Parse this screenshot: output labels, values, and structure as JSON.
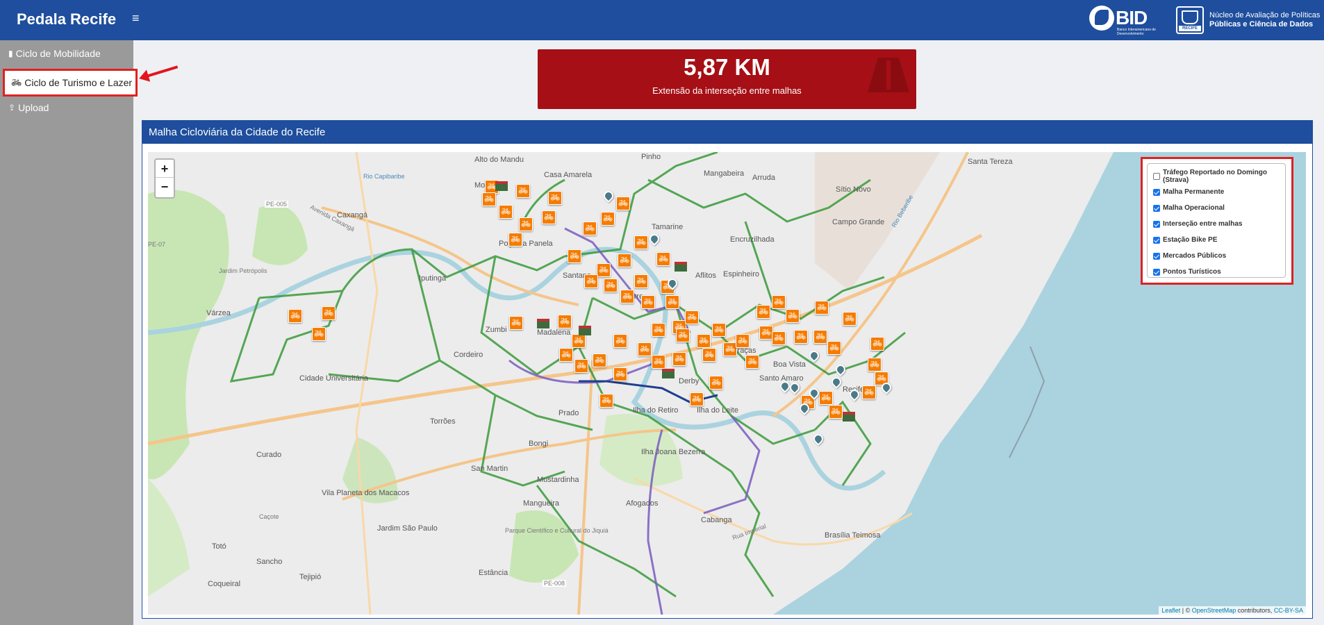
{
  "app": {
    "title": "Pedala Recife",
    "menu_icon": "hamburger-icon"
  },
  "header_logos": {
    "bid": {
      "text": "BID",
      "subtitle": "Banco Interamericano de Desenvolvimento"
    },
    "recife_badge": "RECIFE",
    "nucleo_line1": "Núcleo de Avaliação de Políticas",
    "nucleo_line2": "Públicas e Ciência de Dados"
  },
  "sidebar": {
    "items": [
      {
        "label": "Ciclo de Mobilidade",
        "icon": "traffic-light-icon"
      },
      {
        "label": "Ciclo de Turismo e Lazer",
        "icon": "bicycle-icon",
        "active": true
      },
      {
        "label": "Upload",
        "icon": "upload-icon"
      }
    ]
  },
  "kpi": {
    "value": "5,87 KM",
    "label": "Extensão da interseção entre malhas",
    "icon": "road-icon",
    "color": "#a50f15"
  },
  "panel": {
    "title": "Malha Cicloviária da Cidade do Recife"
  },
  "map": {
    "zoom_in": "+",
    "zoom_out": "−",
    "layers": [
      {
        "label": "Tráfego Reportado no Domingo (Strava)",
        "checked": false
      },
      {
        "label": "Malha Permanente",
        "checked": true
      },
      {
        "label": "Malha Operacional",
        "checked": true
      },
      {
        "label": "Interseção entre malhas",
        "checked": true
      },
      {
        "label": "Estação Bike PE",
        "checked": true
      },
      {
        "label": "Mercados Públicos",
        "checked": true
      },
      {
        "label": "Pontos Turísticos",
        "checked": true
      }
    ],
    "attribution": {
      "leaflet": "Leaflet",
      "sep": " | © ",
      "osm": "OpenStreetMap",
      "contrib": " contributors, ",
      "license": "CC-BY-SA"
    },
    "place_labels": [
      "Alto do Mandu",
      "Pinho",
      "Mangabeira",
      "Arruda",
      "Santa Tereza",
      "Casa Amarela",
      "Monteiro",
      "Sítio Novo",
      "Caxangá",
      "Tamarine",
      "Campo Grande",
      "Poço da Panela",
      "Santana",
      "Iputinga",
      "Jardim Petrópolis",
      "Várzea",
      "Torre",
      "Aflitos",
      "Cordeiro",
      "Cidade Universitária",
      "Derby",
      "Torrões",
      "Prado",
      "Ilha do Retiro",
      "Bongi",
      "Curado",
      "San Martin",
      "Mustardinha",
      "Mangueira",
      "Ilha Joana Bezerra",
      "Vila Planeta dos Macacos",
      "Afogados",
      "Cabanga",
      "Brasília Teimosa",
      "Jardim São Paulo",
      "Sancho",
      "Totó",
      "Tejipió",
      "Coqueiral",
      "Estância",
      "Caçote",
      "Parque Científico e Cultural do Jiquiá",
      "Ilha do Leite",
      "Santo Amaro",
      "Graças",
      "Encruzilhada",
      "Espinheiro",
      "Boa Vista",
      "Recife",
      "Madalena",
      "Zumbi",
      "Iputinga"
    ],
    "road_labels": [
      "PE-005",
      "PE-008",
      "PE-07",
      "Avenida Caxangá",
      "Rua Imperial",
      "Rio Capibaribe",
      "Rio Beberibe"
    ]
  }
}
